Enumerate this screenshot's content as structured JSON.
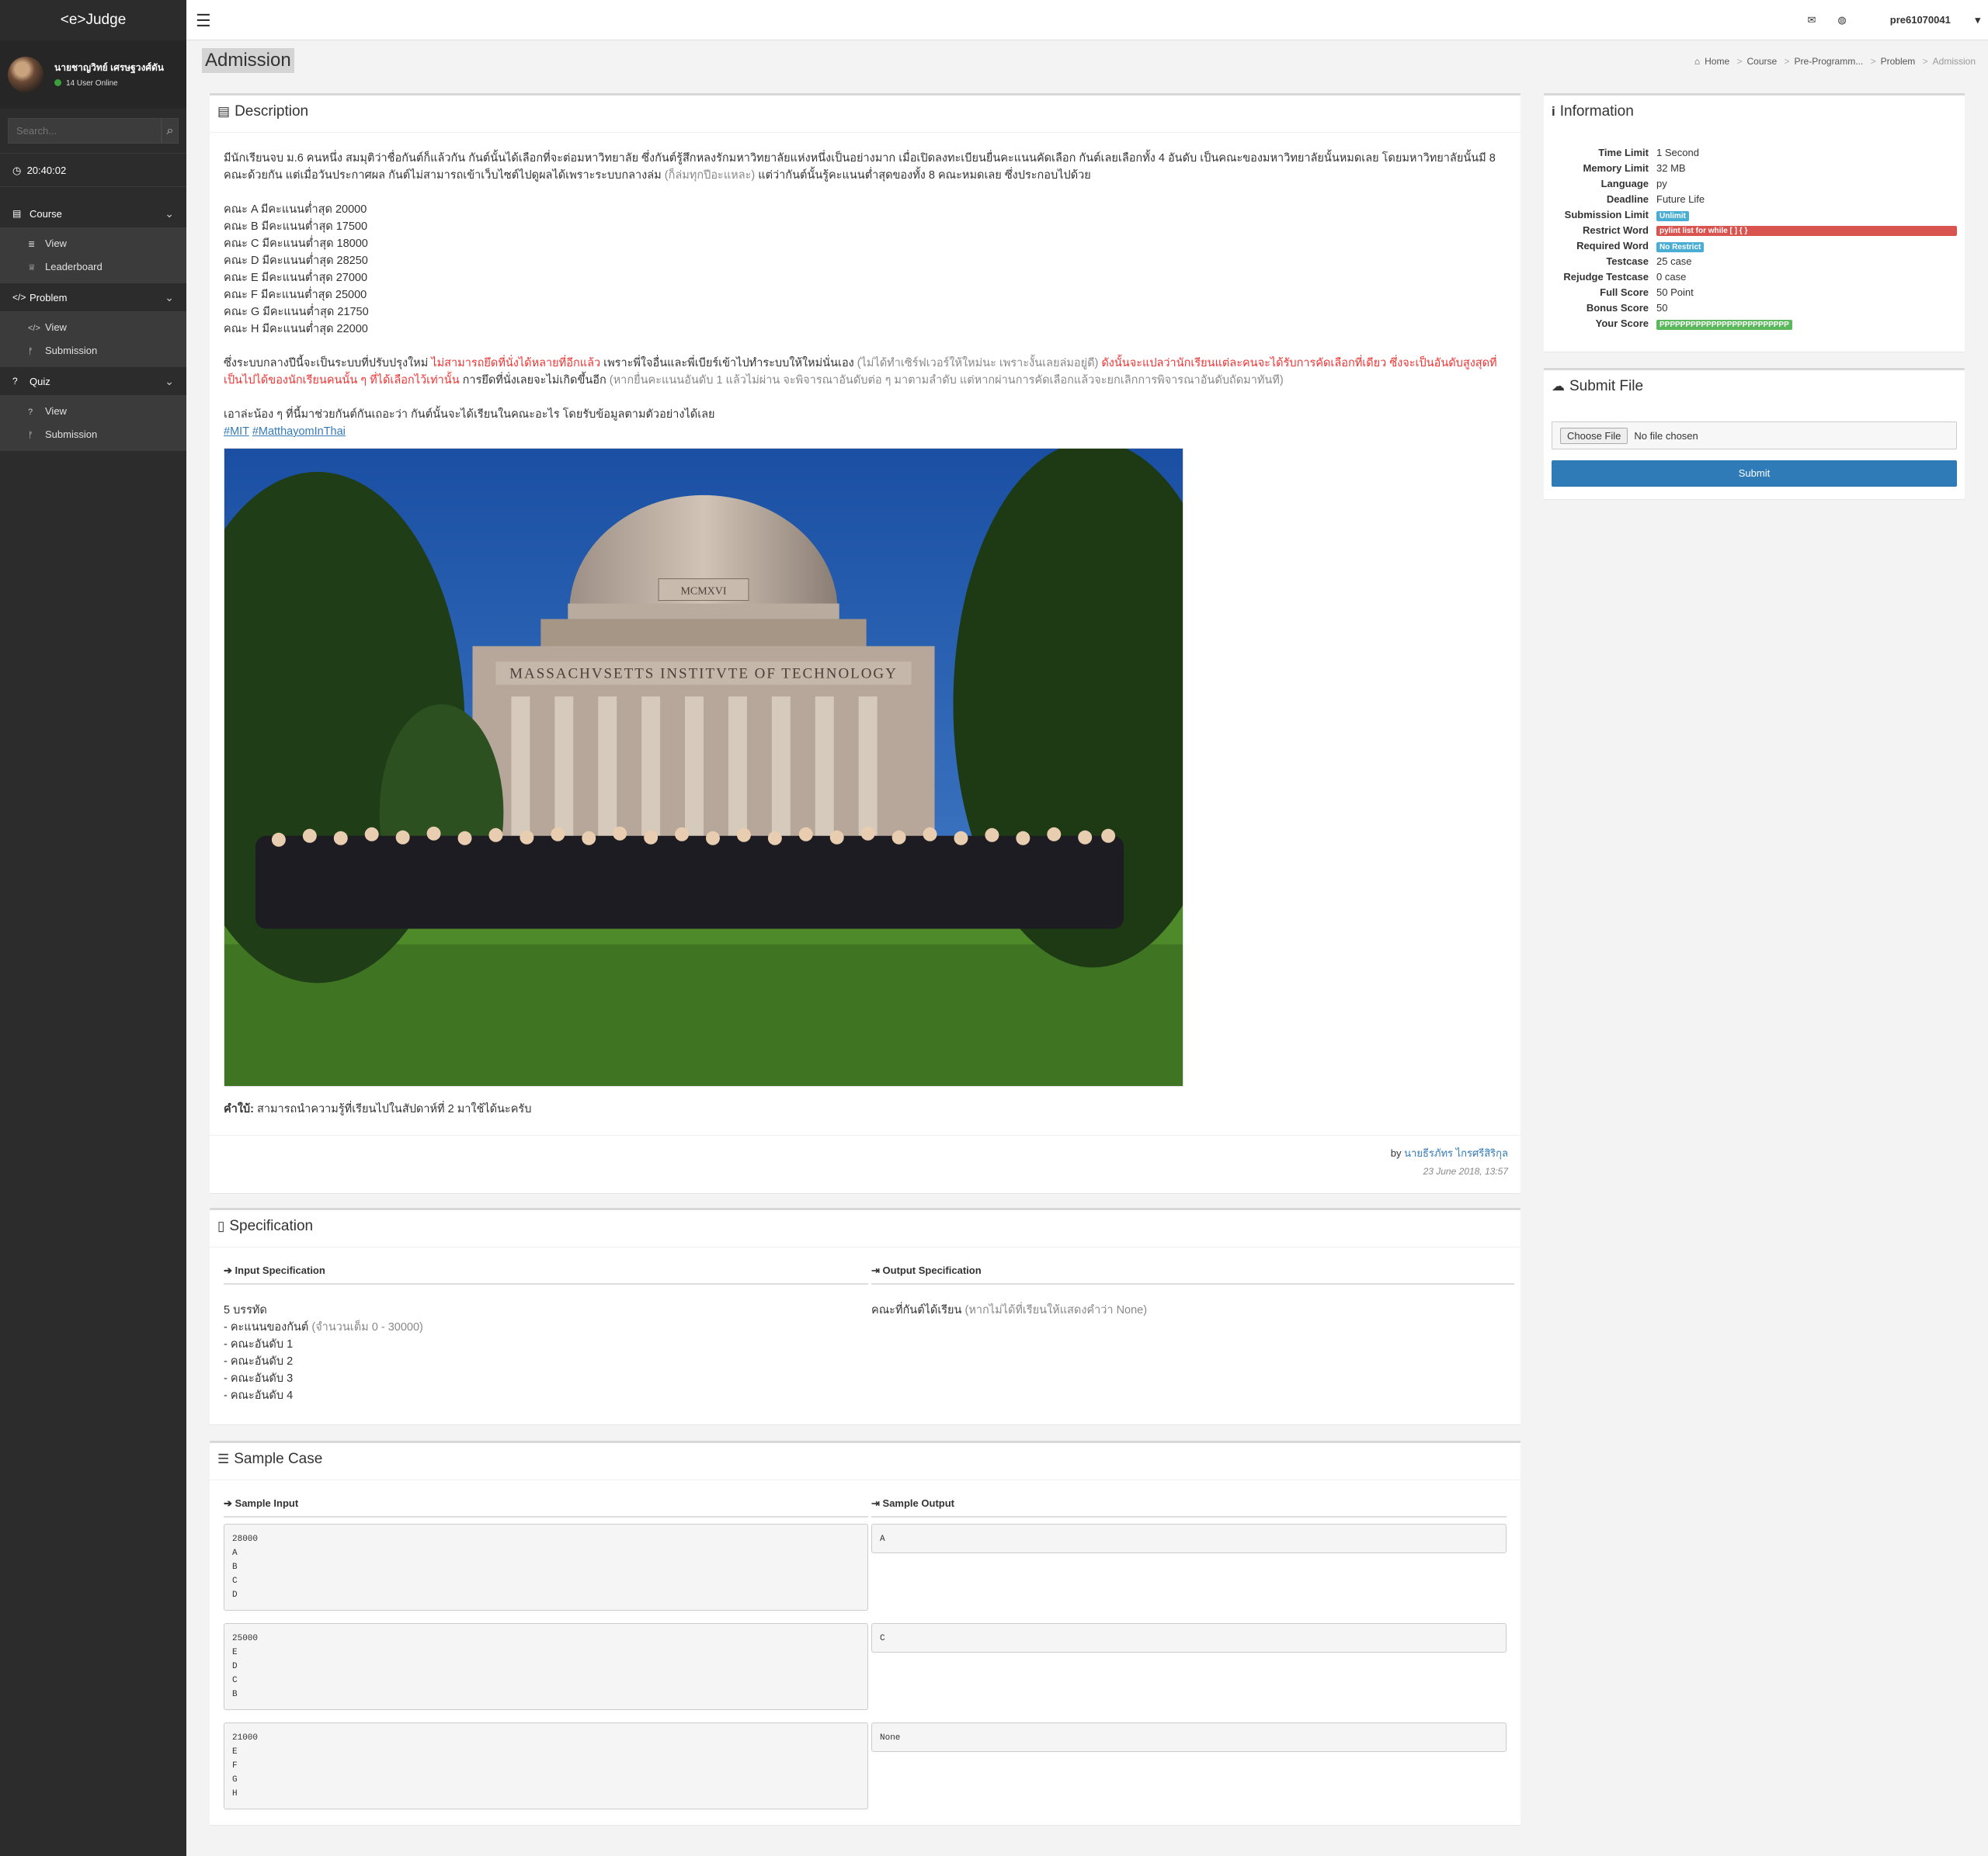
{
  "app": {
    "brand": "<e>Judge"
  },
  "user": {
    "name": "นายชาญวิทย์ เศรษฐวงศ์ดัน",
    "online": "14 User Online",
    "id": "pre61070041"
  },
  "search": {
    "placeholder": "Search..."
  },
  "clock": "20:40:02",
  "menu": [
    {
      "label": "Course",
      "icon": "book-icon",
      "items": [
        {
          "label": "View",
          "icon": "list-icon"
        },
        {
          "label": "Leaderboard",
          "icon": "trophy-icon"
        }
      ]
    },
    {
      "label": "Problem",
      "icon": "code-icon",
      "items": [
        {
          "label": "View",
          "icon": "code-icon"
        },
        {
          "label": "Submission",
          "icon": "branch-icon"
        }
      ]
    },
    {
      "label": "Quiz",
      "icon": "question-icon",
      "items": [
        {
          "label": "View",
          "icon": "question-icon"
        },
        {
          "label": "Submission",
          "icon": "branch-icon"
        }
      ]
    }
  ],
  "page": {
    "title": "Admission"
  },
  "breadcrumb": [
    "Home",
    "Course",
    "Pre-Programm...",
    "Problem",
    "Admission"
  ],
  "description": {
    "title": "Description",
    "intro": "มีนักเรียนจบ ม.6 คนหนึ่ง สมมุติว่าชื่อกันต์ก็แล้วกัน กันต์นั้นได้เลือกที่จะต่อมหาวิทยาลัย ซึ่งกันต์รู้สึกหลงรักมหาวิทยาลัยแห่งหนึ่งเป็นอย่างมาก เมื่อเปิดลงทะเบียนยื่นคะแนนคัดเลือก กันต์เลยเลือกทั้ง 4 อันดับ เป็นคณะของมหาวิทยาลัยนั้นหมดเลย โดยมหาวิทยาลัยนั้นมี 8 คณะด้วยกัน แต่เมื่อวันประกาศผล กันต์ไม่สามารถเข้าเว็บไซต์ไปดูผลได้เพราะระบบกลางล่ม",
    "intro_gray": "(ก็ล่มทุกปีอะแหละ)",
    "intro_end": "แต่ว่ากันต์นั้นรู้คะแนนต่ำสุดของทั้ง 8 คณะหมดเลย ซึ่งประกอบไปด้วย",
    "faculties": [
      "คณะ A มีคะแนนต่ำสุด 20000",
      "คณะ B มีคะแนนต่ำสุด 17500",
      "คณะ C มีคะแนนต่ำสุด 18000",
      "คณะ D มีคะแนนต่ำสุด 28250",
      "คณะ E มีคะแนนต่ำสุด 27000",
      "คณะ F มีคะแนนต่ำสุด 25000",
      "คณะ G มีคะแนนต่ำสุด 21750",
      "คณะ H มีคะแนนต่ำสุด 22000"
    ],
    "p2_a": "ซึ่งระบบกลางปีนี้จะเป็นระบบที่ปรับปรุงใหม่",
    "p2_red1": "ไม่สามารถยึดที่นั่งได้หลายที่อีกแล้ว",
    "p2_b": "เพราะพี่ใจอื่นและพี่เบียร์เข้าไปทำระบบให้ใหม่นั่นเอง",
    "p2_gray1": "(ไม่ได้ทำเซิร์ฟเวอร์ให้ใหม่นะ เพราะงั้นเลยล่มอยู่ดี)",
    "p2_red2": "ดังนั้นจะแปลว่านักเรียนแต่ละคนจะได้รับการคัดเลือกที่เดียว ซึ่งจะเป็นอันดับสูงสุดที่เป็นไปได้ของนักเรียนคนนั้น ๆ ที่ได้เลือกไว้เท่านั้น",
    "p2_c": "การยึดที่นั่งเลยจะไม่เกิดขึ้นอีก",
    "p2_gray2": "(หากยื่นคะแนนอันดับ 1 แล้วไม่ผ่าน จะพิจารณาอันดับต่อ ๆ มาตามลำดับ แต่หากผ่านการคัดเลือกแล้วจะยกเลิกการพิจารณาอันดับถัดมาทันที)",
    "p3": "เอาล่ะน้อง ๆ ที่นี้มาช่วยกันต์กันเถอะว่า กันต์นั้นจะได้เรียนในคณะอะไร โดยรับข้อมูลตามตัวอย่างได้เลย",
    "tags": [
      "#MIT",
      "#MatthayomInThai"
    ],
    "photo_engraving": "MASSACHVSETTS INSTITVTE OF TECHNOLOGY",
    "photo_date": "MCMXVI",
    "hint_label": "คำใบ้:",
    "hint": "สามารถนำความรู้ที่เรียนไปในสัปดาห์ที่ 2 มาใช้ได้นะครับ",
    "by_label": "by",
    "author": "นายธีรภัทร ไกรศรีสิริกุล",
    "date": "23 June 2018, 13:57"
  },
  "specification": {
    "title": "Specification",
    "input_title": "Input Specification",
    "output_title": "Output Specification",
    "input_lines": [
      "5 บรรทัด",
      "- คะแนนของกันต์",
      "- คณะอันดับ 1",
      "- คณะอันดับ 2",
      "- คณะอันดับ 3",
      "- คณะอันดับ 4"
    ],
    "input_note": "(จำนวนเต็ม 0 - 30000)",
    "output_main": "คณะที่กันต์ได้เรียน",
    "output_note": "(หากไม่ได้ที่เรียนให้แสดงคำว่า None)"
  },
  "samples": {
    "title": "Sample Case",
    "input_title": "Sample Input",
    "output_title": "Sample Output",
    "cases": [
      {
        "input": "28000\nA\nB\nC\nD",
        "output": "A"
      },
      {
        "input": "25000\nE\nD\nC\nB",
        "output": "C"
      },
      {
        "input": "21000\nE\nF\nG\nH",
        "output": "None"
      }
    ]
  },
  "information": {
    "title": "Information",
    "rows": [
      {
        "k": "Time Limit",
        "v": "1 Second"
      },
      {
        "k": "Memory Limit",
        "v": "32 MB"
      },
      {
        "k": "Language",
        "v": "py"
      },
      {
        "k": "Deadline",
        "v": "Future Life"
      },
      {
        "k": "Submission Limit",
        "badge": "Unlimit",
        "color": "#4aaed4"
      },
      {
        "k": "Restrict Word",
        "badge": "pylint list for while [ ] { }",
        "color": "#d9534f"
      },
      {
        "k": "Required Word",
        "badge": "No Restrict",
        "color": "#4aaed4"
      },
      {
        "k": "Testcase",
        "v": "25 case"
      },
      {
        "k": "Rejudge Testcase",
        "v": "0 case"
      },
      {
        "k": "Full Score",
        "v": "50 Point"
      },
      {
        "k": "Bonus Score",
        "v": "50"
      },
      {
        "k": "Your Score",
        "badge": "PPPPPPPPPPPPPPPPPPPPPPPPP",
        "color": "#5cb85c"
      }
    ]
  },
  "submit_panel": {
    "title": "Submit File",
    "choose": "Choose File",
    "no_file": "No file chosen",
    "submit": "Submit"
  }
}
